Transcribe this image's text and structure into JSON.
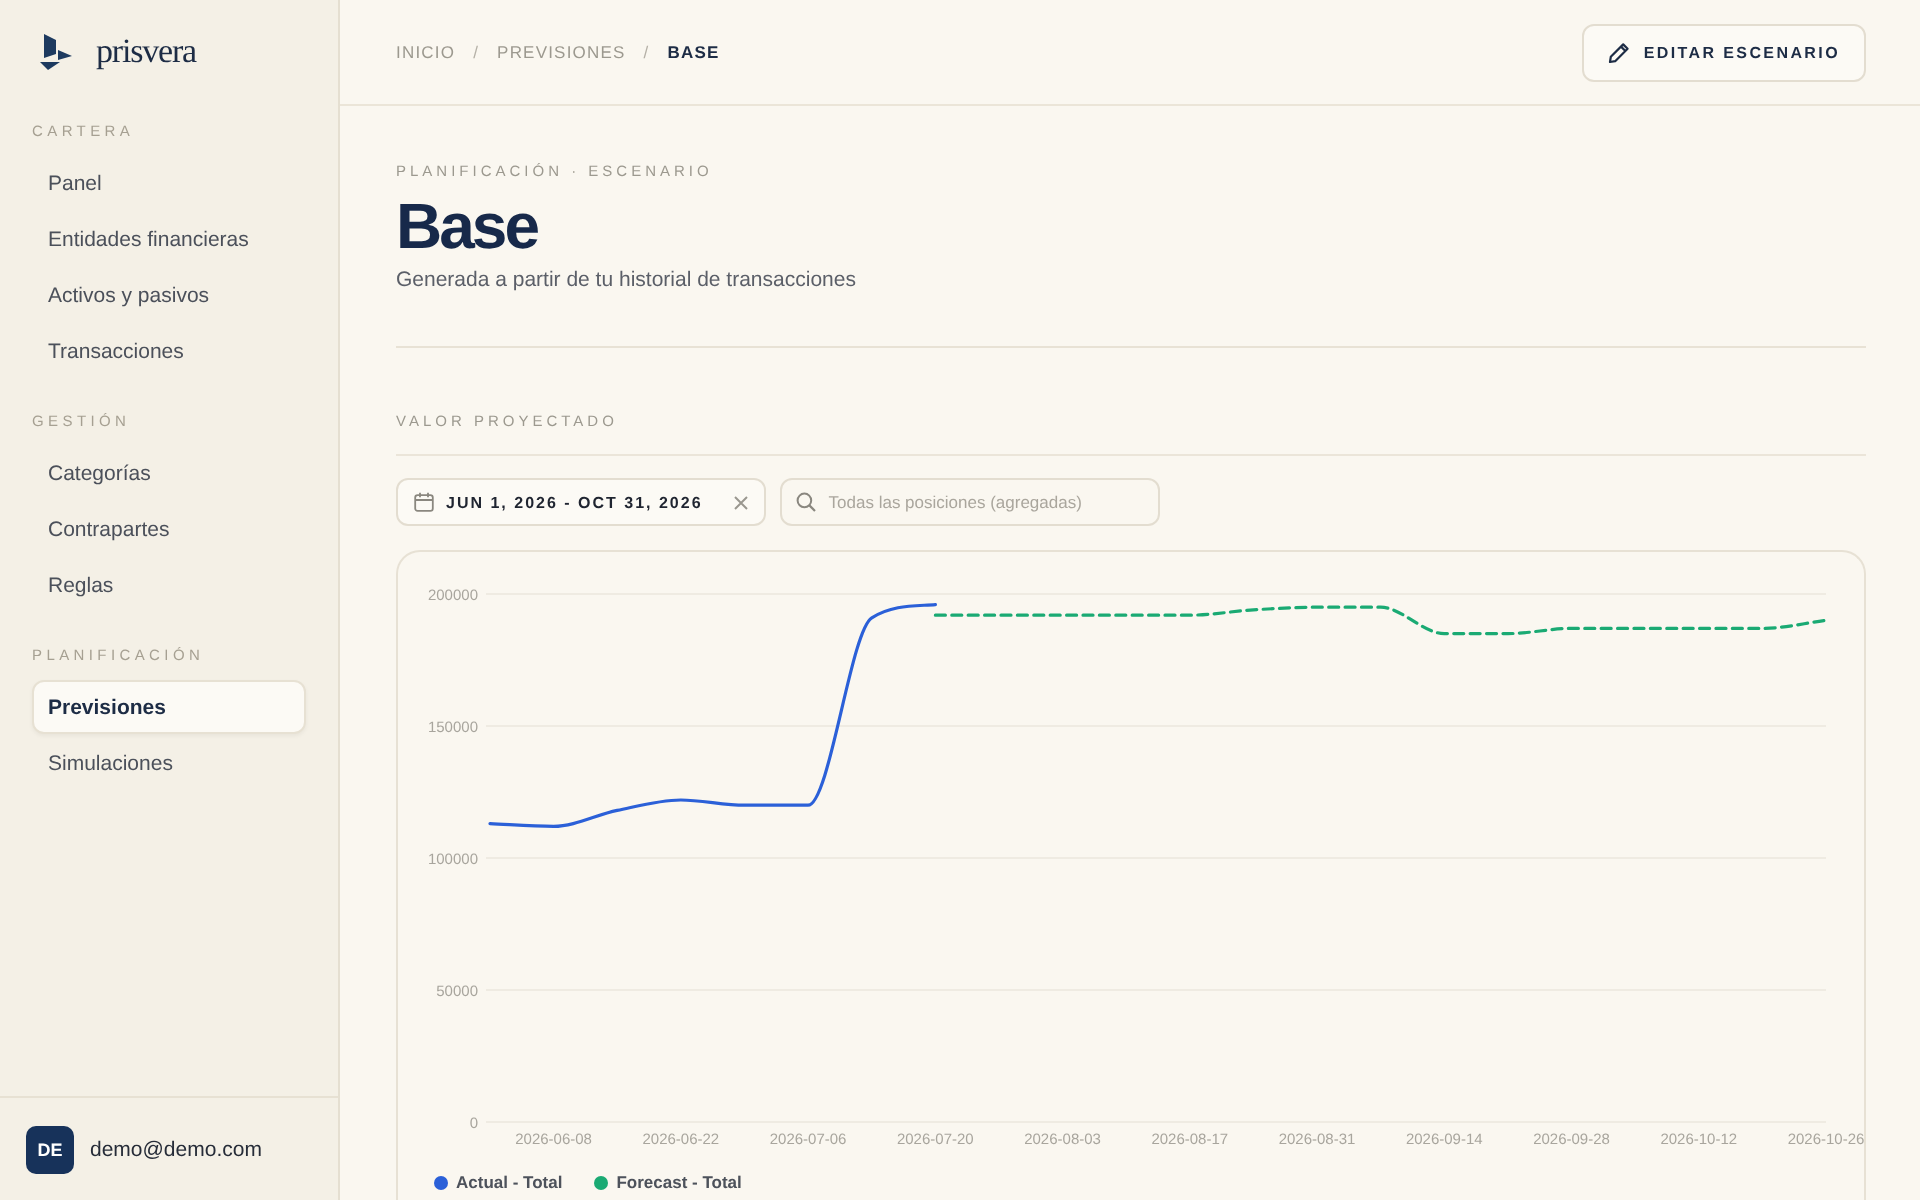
{
  "brand": {
    "name": "prisvera"
  },
  "sidebar": {
    "sections": [
      {
        "title": "CARTERA",
        "items": [
          {
            "label": "Panel",
            "selected": false
          },
          {
            "label": "Entidades financieras",
            "selected": false
          },
          {
            "label": "Activos y pasivos",
            "selected": false
          },
          {
            "label": "Transacciones",
            "selected": false
          }
        ]
      },
      {
        "title": "GESTIÓN",
        "items": [
          {
            "label": "Categorías",
            "selected": false
          },
          {
            "label": "Contrapartes",
            "selected": false
          },
          {
            "label": "Reglas",
            "selected": false
          }
        ]
      },
      {
        "title": "PLANIFICACIÓN",
        "items": [
          {
            "label": "Previsiones",
            "selected": true
          },
          {
            "label": "Simulaciones",
            "selected": false
          }
        ]
      }
    ]
  },
  "user": {
    "initials": "DE",
    "email": "demo@demo.com"
  },
  "breadcrumb": [
    {
      "label": "INICIO",
      "current": false
    },
    {
      "separator": "/",
      "label": "PREVISIONES",
      "current": false
    },
    {
      "separator": "/",
      "label": "BASE",
      "current": true
    }
  ],
  "header_button": {
    "label": "EDITAR ESCENARIO"
  },
  "page": {
    "eyebrow": "PLANIFICACIÓN · ESCENARIO",
    "title": "Base",
    "subtitle": "Generada a partir de tu historial de transacciones"
  },
  "projection": {
    "title": "VALOR PROYECTADO",
    "date_range": {
      "value": "JUN 1, 2026 - OCT 31, 2026"
    },
    "search": {
      "placeholder": "Todas las posiciones (agregadas)"
    },
    "chart": {
      "chart_data": {
        "type": "line",
        "categories": [
          null,
          "2026-06-08",
          null,
          "2026-06-22",
          null,
          "2026-07-06",
          null,
          "2026-07-20",
          null,
          "2026-08-03",
          null,
          "2026-08-17",
          null,
          "2026-08-31",
          null,
          "2026-09-14",
          null,
          "2026-09-28",
          null,
          "2026-10-12",
          null,
          "2026-10-26"
        ],
        "series": [
          {
            "name": "Actual - Total",
            "color": "#2b60d8",
            "line_style": "solid",
            "values": [
              113000,
              112000,
              118000,
              122000,
              120000,
              120000,
              191000,
              196000,
              null,
              null,
              null,
              null,
              null,
              null,
              null,
              null,
              null,
              null,
              null,
              null,
              null,
              null
            ]
          },
          {
            "name": "Forecast - Total",
            "color": "#1aaa73",
            "line_style": "dashed",
            "values": [
              null,
              null,
              null,
              null,
              null,
              null,
              null,
              192000,
              192000,
              192000,
              192000,
              192000,
              194000,
              195000,
              195000,
              185000,
              185000,
              187000,
              187000,
              187000,
              187000,
              190000
            ]
          }
        ],
        "ylim": [
          0,
          200000
        ],
        "yticks": [
          0,
          50000,
          100000,
          150000,
          200000
        ],
        "grid": true,
        "legend": "bottom"
      }
    }
  }
}
